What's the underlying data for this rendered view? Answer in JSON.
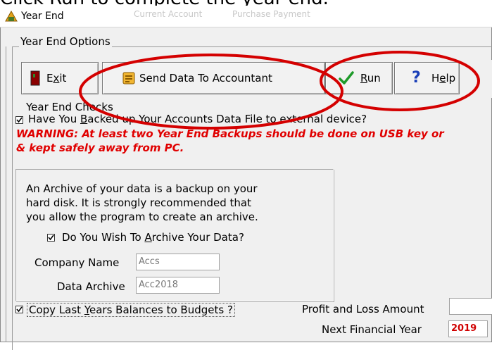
{
  "instruction_partial": "Click Run to complete the year end.",
  "window": {
    "title": "Year End",
    "ghost_tabs": [
      "Current Account",
      "Purchase Payment"
    ]
  },
  "year_end_options": {
    "group_label": "Year End Options",
    "toolbar": {
      "exit": {
        "label_pre": "E",
        "label_ul": "x",
        "label_post": "it",
        "icon": "exit-door-icon"
      },
      "send": {
        "label": "Send Data To Accountant",
        "icon": "send-data-icon"
      },
      "run": {
        "label_ul": "R",
        "label_post": "un",
        "icon": "checkmark-icon"
      },
      "help": {
        "label_pre": "H",
        "label_ul": "e",
        "label_post": "lp",
        "icon": "help-icon"
      }
    }
  },
  "checks": {
    "label": "Year End Checks",
    "backup_checked": true,
    "backup_label_pre": "Have You ",
    "backup_label_ul": "B",
    "backup_label_post": "acked up Your Accounts Data File to external device?",
    "warning_line1": "WARNING: At least two Year End Backups should be done on USB key or",
    "warning_line2": "& kept safely away from PC.",
    "warning_color": "#e00000"
  },
  "archive": {
    "description_lines": [
      "An Archive of your data is a backup on your",
      "hard disk.  It is strongly recommended that",
      "you allow the program to create an archive."
    ],
    "archive_checked": true,
    "archive_label_pre": "Do You Wish To ",
    "archive_label_ul": "A",
    "archive_label_post": "rchive Your Data?",
    "company_name_label": "Company Name",
    "company_name_value": "Accs",
    "data_archive_label": "Data Archive",
    "data_archive_value": "Acc2018"
  },
  "bottom": {
    "budgets_checked": true,
    "budgets_label_pre": "Copy Last ",
    "budgets_label_ul": "Y",
    "budgets_label_post": "ears Balances to Budgets ?",
    "pl_label": "Profit and Loss Amount",
    "pl_value": "",
    "nfy_label": "Next Financial Year",
    "nfy_value": "2019"
  },
  "annotation_color": "#d40000"
}
